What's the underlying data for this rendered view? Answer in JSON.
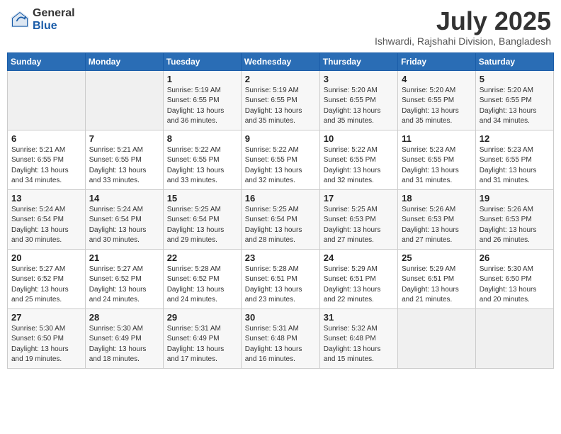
{
  "header": {
    "logo_general": "General",
    "logo_blue": "Blue",
    "title": "July 2025",
    "subtitle": "Ishwardi, Rajshahi Division, Bangladesh"
  },
  "days_of_week": [
    "Sunday",
    "Monday",
    "Tuesday",
    "Wednesday",
    "Thursday",
    "Friday",
    "Saturday"
  ],
  "weeks": [
    [
      {
        "day": "",
        "info": ""
      },
      {
        "day": "",
        "info": ""
      },
      {
        "day": "1",
        "info": "Sunrise: 5:19 AM\nSunset: 6:55 PM\nDaylight: 13 hours and 36 minutes."
      },
      {
        "day": "2",
        "info": "Sunrise: 5:19 AM\nSunset: 6:55 PM\nDaylight: 13 hours and 35 minutes."
      },
      {
        "day": "3",
        "info": "Sunrise: 5:20 AM\nSunset: 6:55 PM\nDaylight: 13 hours and 35 minutes."
      },
      {
        "day": "4",
        "info": "Sunrise: 5:20 AM\nSunset: 6:55 PM\nDaylight: 13 hours and 35 minutes."
      },
      {
        "day": "5",
        "info": "Sunrise: 5:20 AM\nSunset: 6:55 PM\nDaylight: 13 hours and 34 minutes."
      }
    ],
    [
      {
        "day": "6",
        "info": "Sunrise: 5:21 AM\nSunset: 6:55 PM\nDaylight: 13 hours and 34 minutes."
      },
      {
        "day": "7",
        "info": "Sunrise: 5:21 AM\nSunset: 6:55 PM\nDaylight: 13 hours and 33 minutes."
      },
      {
        "day": "8",
        "info": "Sunrise: 5:22 AM\nSunset: 6:55 PM\nDaylight: 13 hours and 33 minutes."
      },
      {
        "day": "9",
        "info": "Sunrise: 5:22 AM\nSunset: 6:55 PM\nDaylight: 13 hours and 32 minutes."
      },
      {
        "day": "10",
        "info": "Sunrise: 5:22 AM\nSunset: 6:55 PM\nDaylight: 13 hours and 32 minutes."
      },
      {
        "day": "11",
        "info": "Sunrise: 5:23 AM\nSunset: 6:55 PM\nDaylight: 13 hours and 31 minutes."
      },
      {
        "day": "12",
        "info": "Sunrise: 5:23 AM\nSunset: 6:55 PM\nDaylight: 13 hours and 31 minutes."
      }
    ],
    [
      {
        "day": "13",
        "info": "Sunrise: 5:24 AM\nSunset: 6:54 PM\nDaylight: 13 hours and 30 minutes."
      },
      {
        "day": "14",
        "info": "Sunrise: 5:24 AM\nSunset: 6:54 PM\nDaylight: 13 hours and 30 minutes."
      },
      {
        "day": "15",
        "info": "Sunrise: 5:25 AM\nSunset: 6:54 PM\nDaylight: 13 hours and 29 minutes."
      },
      {
        "day": "16",
        "info": "Sunrise: 5:25 AM\nSunset: 6:54 PM\nDaylight: 13 hours and 28 minutes."
      },
      {
        "day": "17",
        "info": "Sunrise: 5:25 AM\nSunset: 6:53 PM\nDaylight: 13 hours and 27 minutes."
      },
      {
        "day": "18",
        "info": "Sunrise: 5:26 AM\nSunset: 6:53 PM\nDaylight: 13 hours and 27 minutes."
      },
      {
        "day": "19",
        "info": "Sunrise: 5:26 AM\nSunset: 6:53 PM\nDaylight: 13 hours and 26 minutes."
      }
    ],
    [
      {
        "day": "20",
        "info": "Sunrise: 5:27 AM\nSunset: 6:52 PM\nDaylight: 13 hours and 25 minutes."
      },
      {
        "day": "21",
        "info": "Sunrise: 5:27 AM\nSunset: 6:52 PM\nDaylight: 13 hours and 24 minutes."
      },
      {
        "day": "22",
        "info": "Sunrise: 5:28 AM\nSunset: 6:52 PM\nDaylight: 13 hours and 24 minutes."
      },
      {
        "day": "23",
        "info": "Sunrise: 5:28 AM\nSunset: 6:51 PM\nDaylight: 13 hours and 23 minutes."
      },
      {
        "day": "24",
        "info": "Sunrise: 5:29 AM\nSunset: 6:51 PM\nDaylight: 13 hours and 22 minutes."
      },
      {
        "day": "25",
        "info": "Sunrise: 5:29 AM\nSunset: 6:51 PM\nDaylight: 13 hours and 21 minutes."
      },
      {
        "day": "26",
        "info": "Sunrise: 5:30 AM\nSunset: 6:50 PM\nDaylight: 13 hours and 20 minutes."
      }
    ],
    [
      {
        "day": "27",
        "info": "Sunrise: 5:30 AM\nSunset: 6:50 PM\nDaylight: 13 hours and 19 minutes."
      },
      {
        "day": "28",
        "info": "Sunrise: 5:30 AM\nSunset: 6:49 PM\nDaylight: 13 hours and 18 minutes."
      },
      {
        "day": "29",
        "info": "Sunrise: 5:31 AM\nSunset: 6:49 PM\nDaylight: 13 hours and 17 minutes."
      },
      {
        "day": "30",
        "info": "Sunrise: 5:31 AM\nSunset: 6:48 PM\nDaylight: 13 hours and 16 minutes."
      },
      {
        "day": "31",
        "info": "Sunrise: 5:32 AM\nSunset: 6:48 PM\nDaylight: 13 hours and 15 minutes."
      },
      {
        "day": "",
        "info": ""
      },
      {
        "day": "",
        "info": ""
      }
    ]
  ]
}
